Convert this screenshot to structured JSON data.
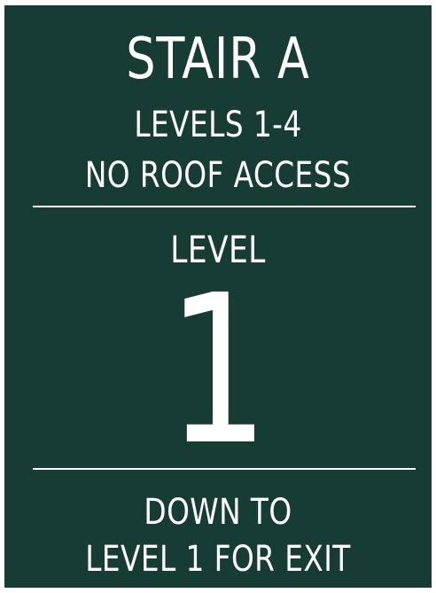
{
  "sign": {
    "background_color": "#173b35",
    "text_color": "#ffffff",
    "title": "STAIR A",
    "levels_served": "LEVELS 1-4",
    "roof_note": "NO ROOF ACCESS",
    "level_label": "LEVEL",
    "level_number": "1",
    "exit_line_1": "DOWN TO",
    "exit_line_2": "LEVEL 1 FOR EXIT"
  }
}
